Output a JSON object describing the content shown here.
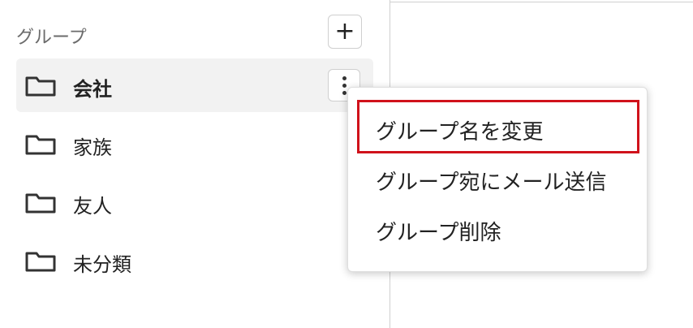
{
  "sidebar": {
    "header": "グループ",
    "add_button": "+",
    "groups": [
      {
        "label": "会社",
        "icon": "folder-icon",
        "active": true
      },
      {
        "label": "家族",
        "icon": "folder-icon"
      },
      {
        "label": "友人",
        "icon": "folder-icon"
      },
      {
        "label": "未分類",
        "icon": "folder-icon"
      }
    ]
  },
  "context_menu": {
    "items": [
      {
        "label": "グループ名を変更",
        "highlighted": true
      },
      {
        "label": "グループ宛にメール送信"
      },
      {
        "label": "グループ削除"
      }
    ],
    "highlight_color": "#d0121b"
  },
  "colors": {
    "active_bg": "#f2f2f2",
    "border": "#cfcfcf",
    "text": "#222222",
    "muted": "#6b6b6b"
  }
}
